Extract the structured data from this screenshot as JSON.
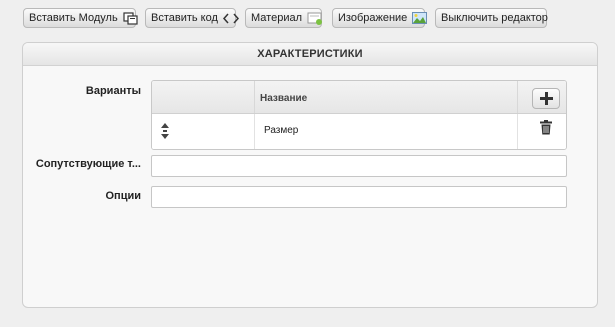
{
  "toolbar": {
    "insert_module": "Вставить Модуль",
    "insert_code": "Вставить код",
    "material": "Материал",
    "image": "Изображение",
    "disable_editor": "Выключить редактор"
  },
  "panel": {
    "title": "ХАРАКТЕРИСТИКИ",
    "variants": {
      "label": "Варианты",
      "column_name": "Название",
      "rows": [
        {
          "name": "Размер"
        }
      ]
    },
    "related": {
      "label": "Сопутствующие т...",
      "value": ""
    },
    "options": {
      "label": "Опции",
      "value": ""
    }
  },
  "colors": {
    "add": "#333333",
    "trash": "#333333",
    "image_icon": "#3c8fd4"
  }
}
